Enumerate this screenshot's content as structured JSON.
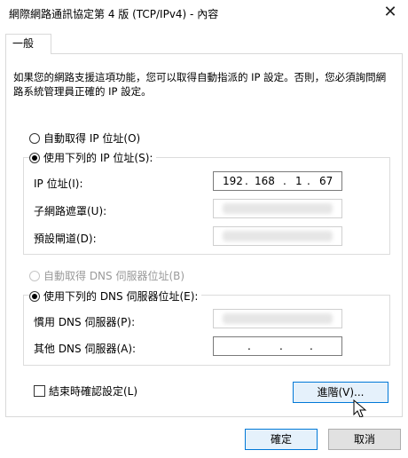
{
  "window": {
    "title": "網際網路通訊協定第 4 版 (TCP/IPv4) - 內容",
    "close_glyph": "✕"
  },
  "tabs": [
    {
      "label": "一般"
    }
  ],
  "description": "如果您的網路支援這項功能，您可以取得自動指派的 IP 設定。否則，您必須詢問網路系統管理員正確的 IP 設定。",
  "ip_section": {
    "auto_option": "自動取得 IP 位址(O)",
    "manual_option": "使用下列的 IP 位址(S):",
    "ip_label": "IP 位址(I):",
    "ip_octets": [
      "192",
      "168",
      "1",
      "67"
    ],
    "subnet_label": "子網路遮罩(U):",
    "gateway_label": "預設閘道(D):",
    "selected": "manual"
  },
  "dns_section": {
    "auto_option": "自動取得 DNS 伺服器位址(B)",
    "manual_option": "使用下列的 DNS 伺服器位址(E):",
    "preferred_label": "慣用 DNS 伺服器(P):",
    "alternate_label": "其他 DNS 伺服器(A):",
    "dot": ".",
    "selected": "manual"
  },
  "validate_on_exit_label": "結束時確認設定(L)",
  "advanced_button": "進階(V)...",
  "ok_button": "確定",
  "cancel_button": "取消"
}
